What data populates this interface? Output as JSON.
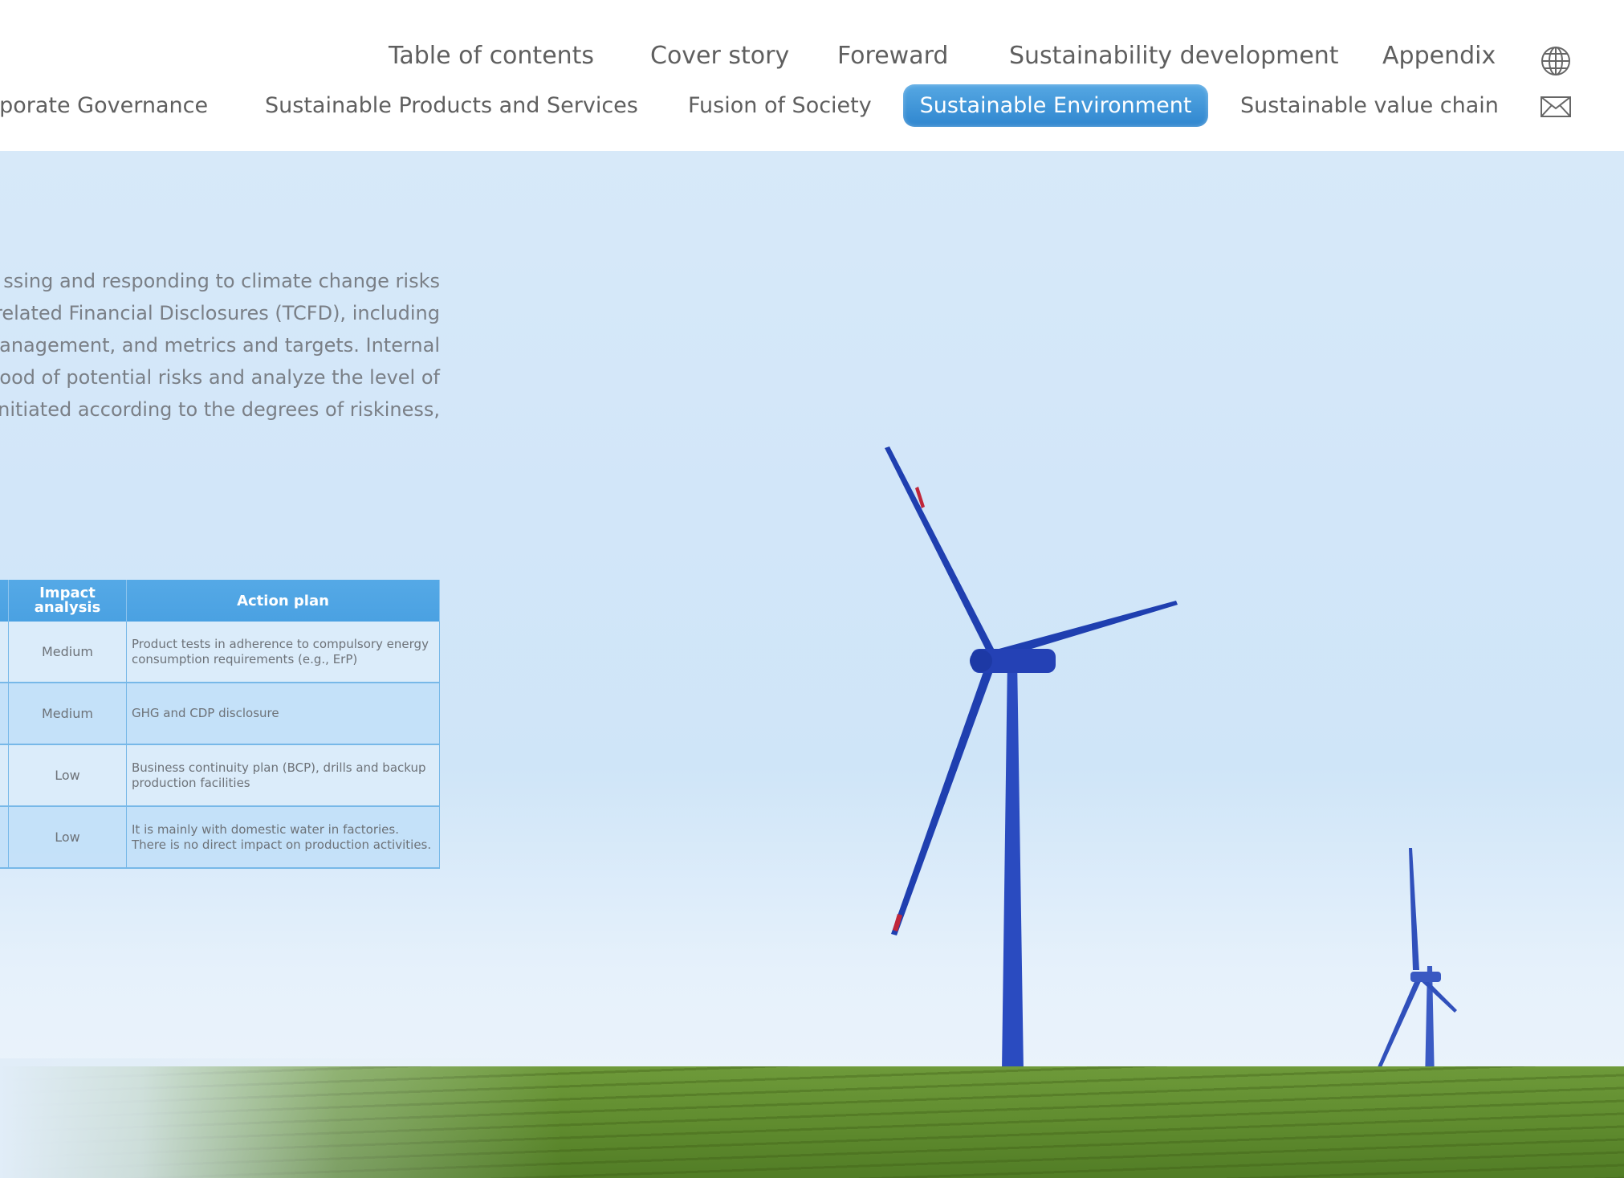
{
  "nav": {
    "row1": [
      "Table of contents",
      "Cover story",
      "Foreward",
      "Sustainability development",
      "Appendix"
    ],
    "row2": [
      "rporate Governance",
      "Sustainable Products and Services",
      "Fusion of Society",
      "Sustainable Environment",
      "Sustainable value chain"
    ],
    "active": "Sustainable Environment",
    "icons": [
      "globe-icon",
      "mail-icon"
    ]
  },
  "paragraph": {
    "lines": [
      "ssing and responding to climate change risks",
      "related Financial Disclosures (TCFD), including",
      "anagement, and metrics and targets. Internal",
      "ood of potential risks and analyze the level of",
      "initiated according to the degrees of riskiness,"
    ]
  },
  "table": {
    "headers": {
      "impact": "Impact analysis",
      "action": "Action plan"
    },
    "rows": [
      {
        "impact": "Medium",
        "action": "Product tests in adherence to compulsory energy consumption requirements (e.g., ErP)"
      },
      {
        "impact": "Medium",
        "action": "GHG and CDP disclosure"
      },
      {
        "impact": "Low",
        "action": "Business continuity plan (BCP), drills and backup production facilities"
      },
      {
        "impact": "Low",
        "action": "It is mainly with domestic water in factories. There is no direct impact on production activities."
      }
    ]
  },
  "colors": {
    "accent": "#3b93d8",
    "sky": "#d2e6f9",
    "grass": "#5f8b2e",
    "turbine": "#1f3fb0",
    "blade_tip": "#c0263a"
  }
}
